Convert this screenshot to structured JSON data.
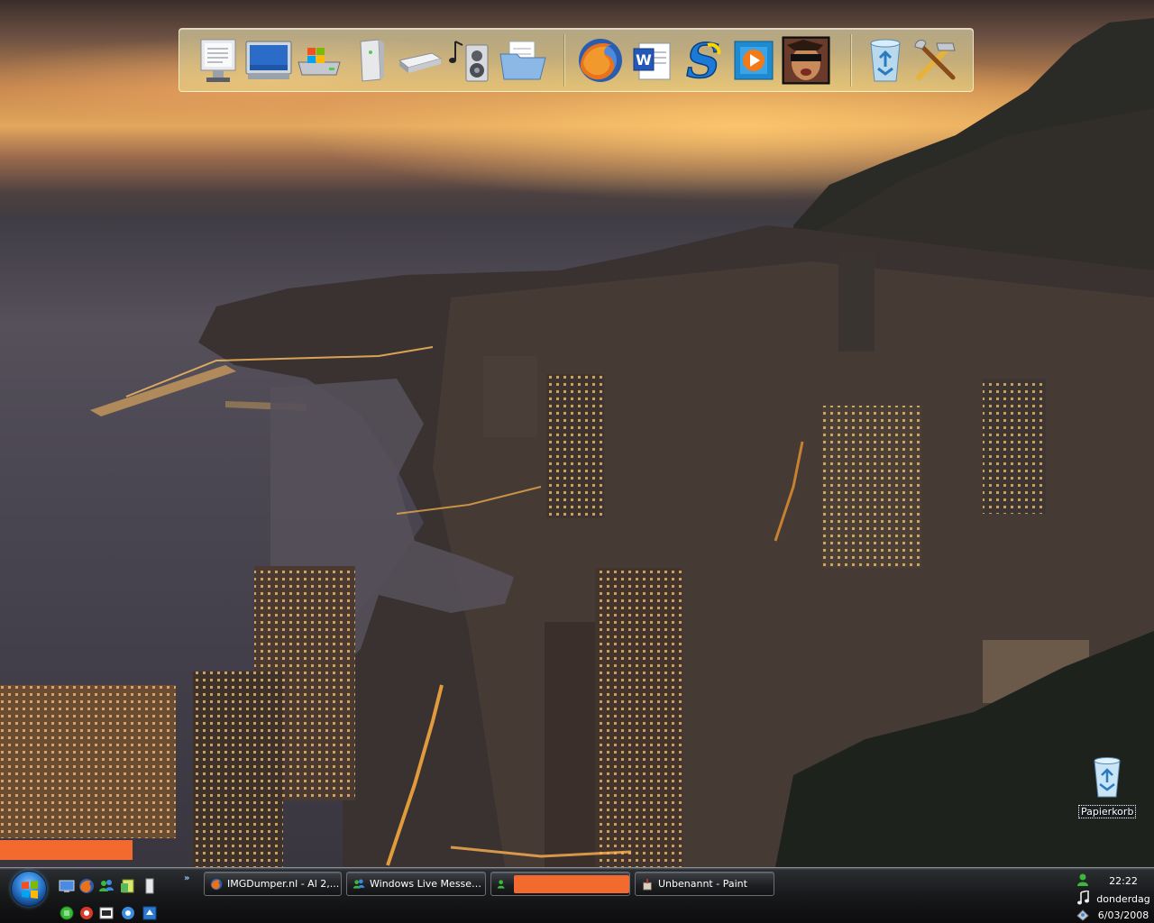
{
  "desktop": {
    "recycle_bin_label": "Papierkorb"
  },
  "dock": {
    "items": [
      {
        "name": "control-panel"
      },
      {
        "name": "my-computer"
      },
      {
        "name": "windows-drive"
      },
      {
        "name": "tower-drive"
      },
      {
        "name": "removable-drive"
      },
      {
        "name": "music-folder"
      },
      {
        "name": "documents-folder"
      },
      {
        "name": "firefox"
      },
      {
        "name": "word"
      },
      {
        "name": "skype-s"
      },
      {
        "name": "media-player"
      },
      {
        "name": "game-avatar"
      },
      {
        "name": "recycle-bin"
      },
      {
        "name": "tools"
      }
    ]
  },
  "taskbar": {
    "tasks": [
      {
        "label": "IMGDumper.nl - Al 2,...",
        "icon": "firefox-icon",
        "active": false
      },
      {
        "label": "Windows Live Messen...",
        "icon": "messenger-icon",
        "active": false
      },
      {
        "label": "",
        "icon": "messenger-icon",
        "active": false,
        "redacted": true
      },
      {
        "label": "Unbenannt - Paint",
        "icon": "paint-icon",
        "active": false
      }
    ],
    "quick_launch_more": "»"
  },
  "tray": {
    "time": "22:22",
    "day": "donderdag",
    "date": "6/03/2008"
  },
  "colors": {
    "redaction": "#f26a2e",
    "taskbar": "#111214",
    "dock_glass": "#f0eca0"
  }
}
